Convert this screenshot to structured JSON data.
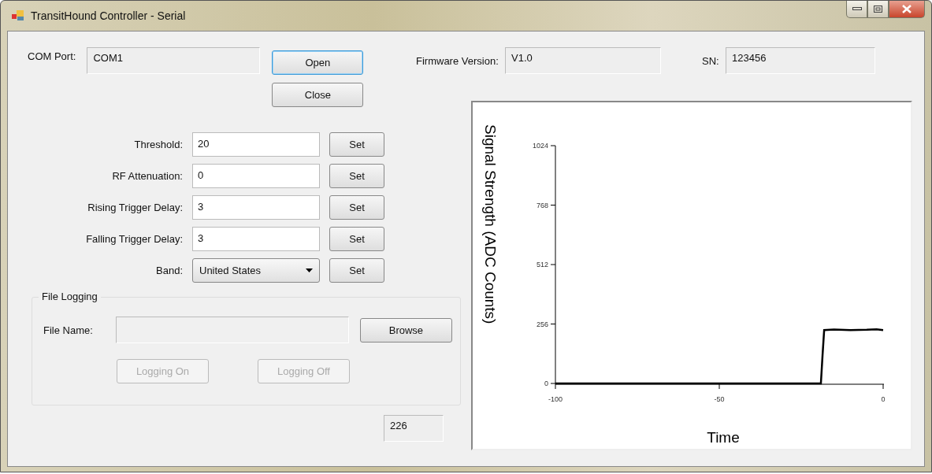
{
  "window": {
    "title": "TransitHound Controller - Serial"
  },
  "com_port": {
    "label": "COM Port:",
    "value": "COM1"
  },
  "buttons": [
    {
      "label": "Open",
      "focused": true
    },
    {
      "label": "Close",
      "focused": false
    }
  ],
  "firmware": {
    "label": "Firmware Version:",
    "value": "V1.0"
  },
  "serial_number": {
    "label": "SN:",
    "value": "123456"
  },
  "settings": [
    {
      "kind": "text",
      "label": "Threshold:",
      "value": "20",
      "button": "Set"
    },
    {
      "kind": "text",
      "label": "RF Attenuation:",
      "value": "0",
      "button": "Set"
    },
    {
      "kind": "text",
      "label": "Rising Trigger Delay:",
      "value": "3",
      "button": "Set"
    },
    {
      "kind": "text",
      "label": "Falling Trigger Delay:",
      "value": "3",
      "button": "Set"
    },
    {
      "kind": "dropdown",
      "label": "Band:",
      "value": "United States",
      "button": "Set"
    }
  ],
  "file_logging": {
    "title": "File Logging",
    "file_name_label": "File Name:",
    "browse": "Browse",
    "actions": [
      {
        "label": "Logging On",
        "disabled": true
      },
      {
        "label": "Logging Off",
        "disabled": true
      }
    ]
  },
  "counter": "226",
  "chart": {
    "chart_data": {
      "type": "line",
      "xlabel": "Time",
      "ylabel": "Signal Strength (ADC Counts)",
      "x": [
        -100,
        -19,
        -18.5,
        -18,
        -15,
        -10,
        -5,
        -2,
        0
      ],
      "series": [
        {
          "color": "#000000",
          "values": [
            0,
            0,
            120,
            230,
            232,
            230,
            231,
            233,
            230
          ]
        }
      ],
      "xlim": [
        -100,
        0
      ],
      "ylim": [
        0,
        1024
      ],
      "xticks": [
        -100,
        -50,
        0
      ],
      "yticks": [
        0,
        256,
        512,
        768,
        1024
      ]
    }
  }
}
